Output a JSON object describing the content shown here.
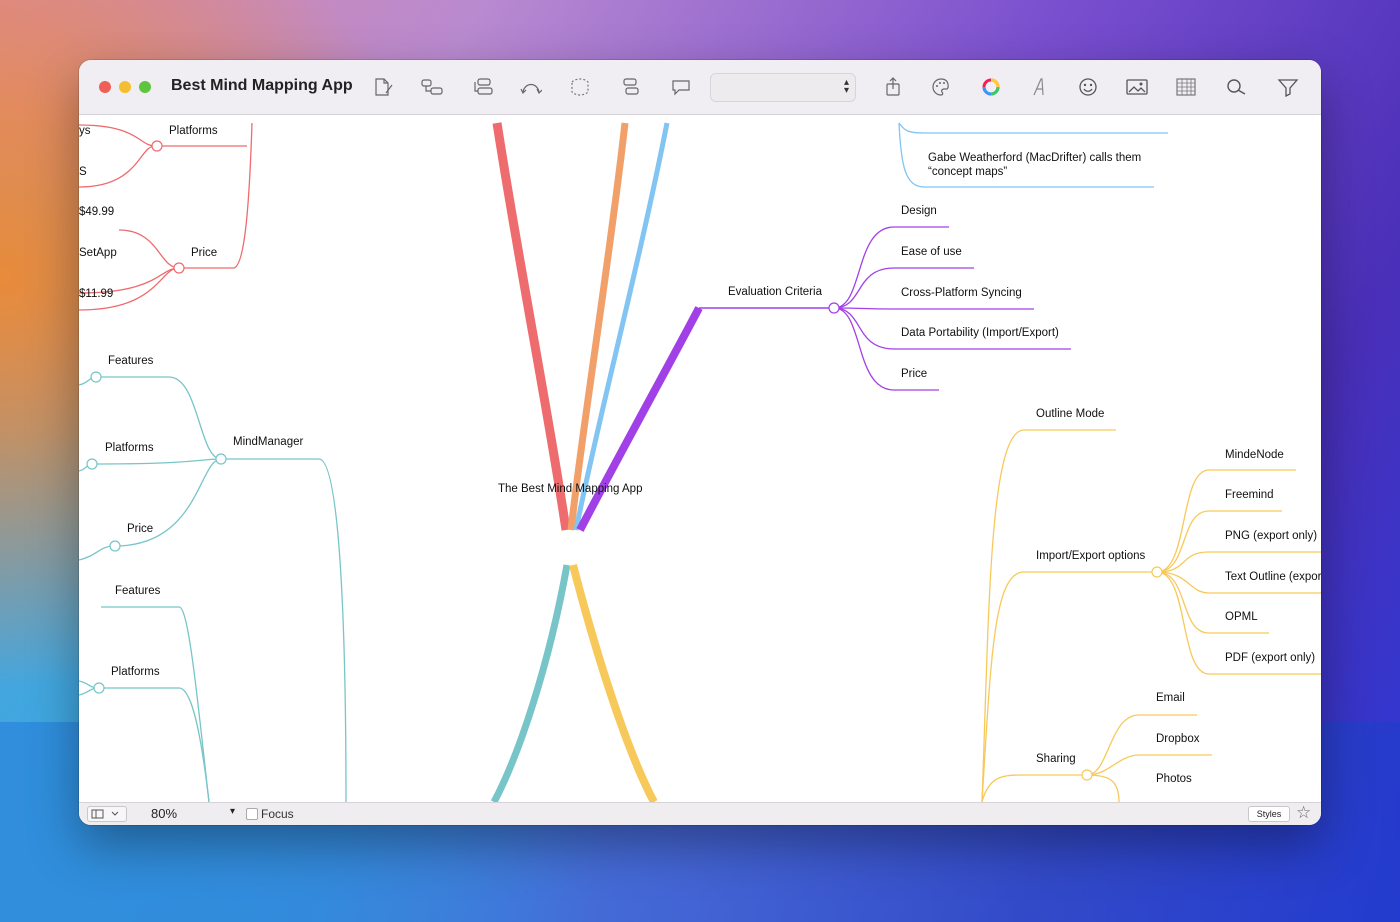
{
  "window": {
    "title": "Best Mind Mapping App"
  },
  "toolbar": {
    "icons": [
      "new-document-icon",
      "add-child-icon",
      "add-sibling-icon",
      "connect-icon",
      "boundary-icon",
      "outline-icon",
      "comment-icon",
      "share-icon",
      "palette-icon",
      "color-wheel-icon",
      "font-icon",
      "emoji-icon",
      "image-icon",
      "table-icon",
      "search-icon",
      "filter-icon"
    ],
    "style_select_value": ""
  },
  "mindmap": {
    "central": "The Best Mind Mapping App",
    "colors": {
      "red": "#ee6b6e",
      "orange": "#f2a06a",
      "blue": "#82c4f2",
      "purple": "#a240e8",
      "teal": "#77c5c8",
      "yellow": "#f7c95a"
    },
    "left_top": {
      "partial": [
        "ys",
        "S",
        "$49.99",
        "SetApp",
        "$11.99"
      ],
      "platforms": "Platforms",
      "price": "Price"
    },
    "mindmanager": {
      "label": "MindManager",
      "children": [
        "Features",
        "Platforms",
        "Price"
      ]
    },
    "left_bottom": {
      "children": [
        "Features",
        "Platforms"
      ]
    },
    "top_right": {
      "note": "Gabe Weatherford (MacDrifter) calls them “concept maps”"
    },
    "evaluation": {
      "label": "Evaluation Criteria",
      "children": [
        "Design",
        "Ease of use",
        "Cross-Platform Syncing",
        "Data Portability (Import/Export)",
        "Price"
      ]
    },
    "right_bottom": {
      "outline_mode": "Outline Mode",
      "import_export": {
        "label": "Import/Export options",
        "children": [
          "MindeNode",
          "Freemind",
          "PNG (export only)",
          "Text Outline (export",
          "OPML",
          "PDF (export only)"
        ]
      },
      "sharing": {
        "label": "Sharing",
        "children": [
          "Email",
          "Dropbox",
          "Photos"
        ]
      }
    }
  },
  "statusbar": {
    "zoom": "80%",
    "focus_label": "Focus",
    "styles_label": "Styles"
  }
}
